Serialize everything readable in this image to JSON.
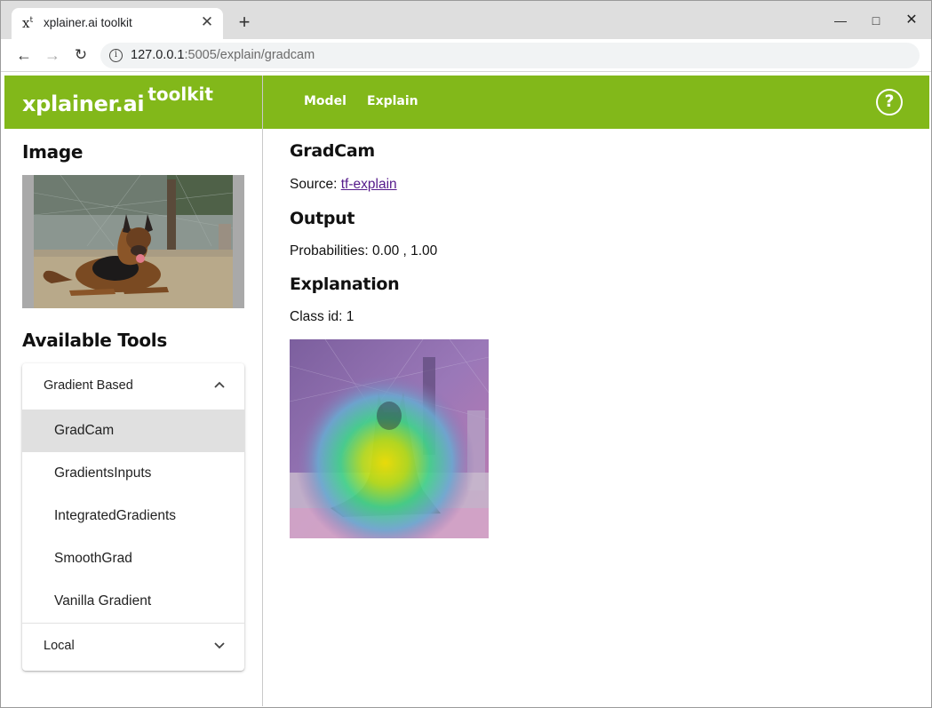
{
  "browser": {
    "tab_title": "xplainer.ai toolkit",
    "favicon_text": "x",
    "favicon_sup": "t",
    "url_host": "127.0.0.1",
    "url_rest": ":5005/explain/gradcam"
  },
  "header": {
    "brand": "xplainer.ai",
    "brand_sup": "toolkit",
    "nav": [
      "Model",
      "Explain"
    ],
    "help_symbol": "?"
  },
  "sidebar": {
    "image_heading": "Image",
    "tools_heading": "Available Tools",
    "groups": [
      {
        "label": "Gradient Based",
        "expanded": true,
        "items": [
          "GradCam",
          "GradientsInputs",
          "IntegratedGradients",
          "SmoothGrad",
          "Vanilla Gradient"
        ],
        "selected": "GradCam"
      },
      {
        "label": "Local",
        "expanded": false
      }
    ]
  },
  "main": {
    "title": "GradCam",
    "source_label": "Source:",
    "source_link": "tf-explain",
    "output_heading": "Output",
    "probabilities": "Probabilities: 0.00 , 1.00",
    "explanation_heading": "Explanation",
    "class_id": "Class id: 1"
  },
  "icons": {
    "back": "arrow-left-icon",
    "forward": "arrow-right-icon",
    "reload": "reload-icon",
    "info": "info-icon",
    "help": "help-circle-icon",
    "expand_less": "chevron-up-icon",
    "expand_more": "chevron-down-icon"
  },
  "colors": {
    "brand_green": "#82b81a",
    "selected_item_bg": "#e0e0e0",
    "link": "#551a8b"
  }
}
